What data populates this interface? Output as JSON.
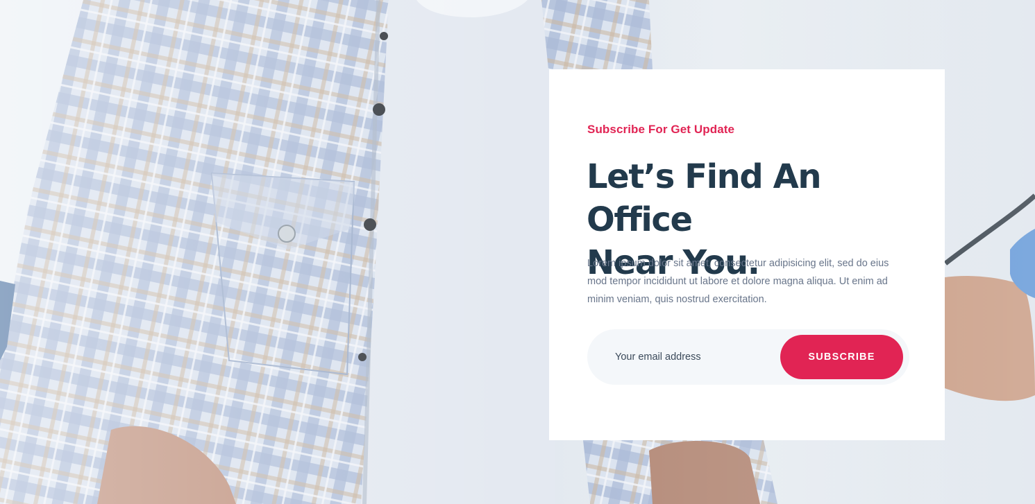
{
  "subscribe": {
    "eyebrow": "Subscribe For Get Update",
    "heading_line1": "Let’s Find An Office",
    "heading_line2": "Near You.",
    "description": "Lorem ipsum dolor sit amet, consectetur adipisicing elit, sed do eius mod tempor incididunt ut labore et dolore magna aliqua. Ut enim ad minim veniam, quis nostrud exercitation.",
    "email_placeholder": "Your email address",
    "email_value": "",
    "button_label": "SUBSCRIBE"
  },
  "colors": {
    "accent": "#e12454",
    "heading": "#223a4c",
    "body_text": "#68758a",
    "input_background": "#f4f7fa",
    "card_background": "#ffffff"
  },
  "background": {
    "icon": "doctor-patient-photo"
  }
}
